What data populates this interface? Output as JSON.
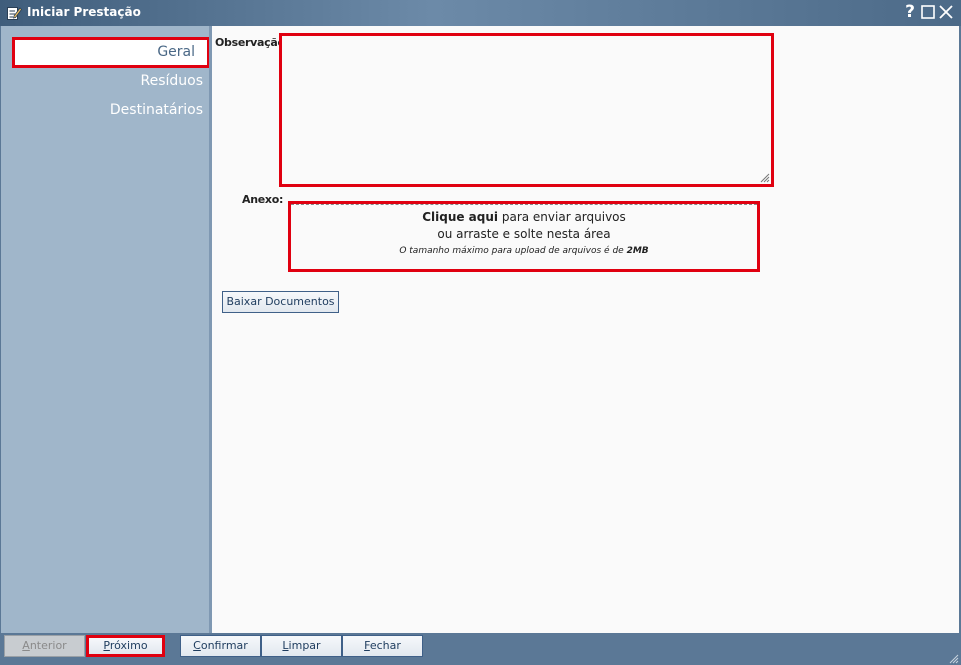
{
  "window": {
    "title": "Iniciar Prestação",
    "icons": {
      "title": "edit-document-icon",
      "help": "help-icon",
      "maximize": "maximize-icon",
      "close": "close-icon"
    },
    "help_label": "?"
  },
  "sidebar": {
    "items": [
      {
        "label": "Geral",
        "active": true
      },
      {
        "label": "Resíduos",
        "active": false
      },
      {
        "label": "Destinatários",
        "active": false
      }
    ]
  },
  "form": {
    "observacao_label": "Observação:",
    "observacao_value": "",
    "anexo_label": "Anexo:",
    "upload": {
      "click_bold": "Clique aqui",
      "click_rest": " para enviar arquivos",
      "drag_text": "ou arraste e solte nesta área",
      "size_text": "O tamanho máximo para upload de arquivos é de ",
      "size_value": "2MB"
    },
    "download_button": "Baixar Documentos"
  },
  "footer": {
    "anterior": {
      "first": "A",
      "rest": "nterior"
    },
    "proximo": {
      "first": "P",
      "rest": "róximo"
    },
    "confirmar": {
      "first": "C",
      "rest": "onfirmar"
    },
    "limpar": {
      "first": "L",
      "rest": "impar"
    },
    "fechar": {
      "first": "F",
      "rest": "echar"
    }
  },
  "colors": {
    "highlight": "#e00010",
    "sidebar_bg": "#a0b6ca",
    "frame": "#5b7896",
    "content_bg": "#fafafa"
  }
}
